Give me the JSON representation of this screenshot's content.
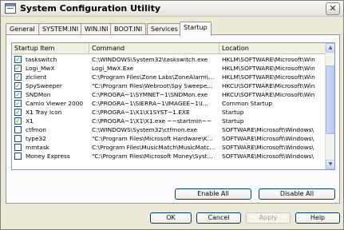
{
  "window": {
    "title": "System Configuration Utility",
    "close_symbol": "✕"
  },
  "tabs": [
    "General",
    "SYSTEM.INI",
    "WIN.INI",
    "BOOT.INI",
    "Services",
    "Startup"
  ],
  "active_tab": "Startup",
  "list": {
    "columns": [
      "Startup Item",
      "Command",
      "Location"
    ],
    "rows": [
      {
        "checked": true,
        "item": "taskswitch",
        "command": "C:\\WINDOWS\\System32\\taskswitch.exe",
        "location": "HKLM\\SOFTWARE\\Microsoft\\Win"
      },
      {
        "checked": true,
        "item": "Logi_MwX",
        "command": "Logi_MwX.Exe",
        "location": "HKLM\\SOFTWARE\\Microsoft\\Win"
      },
      {
        "checked": true,
        "item": "zlclient",
        "command": "C:\\Program Files\\Zone Labs\\ZoneAlarm\\...",
        "location": "HKLM\\SOFTWARE\\Microsoft\\Win"
      },
      {
        "checked": true,
        "item": "SpySweeper",
        "command": "\"C:\\Program Files\\Webroot\\Spy Sweepe...",
        "location": "HKCU\\SOFTWARE\\Microsoft\\Win"
      },
      {
        "checked": true,
        "item": "SNDMon",
        "command": "C:\\PROGRA~1\\SYMNET~1\\SNDMon.exe",
        "location": "HKCU\\SOFTWARE\\Microsoft\\Win"
      },
      {
        "checked": true,
        "item": "Camio Viewer 2000",
        "command": "C:\\PROGRA~1\\SIERRA~1\\IMAGEE~1\\I...",
        "location": "Common Startup"
      },
      {
        "checked": true,
        "item": "X1 Tray Icon",
        "command": "C:\\PROGRA~1\\X1\\X1SYST~1.EXE",
        "location": "Startup"
      },
      {
        "checked": true,
        "item": "X1",
        "command": "C:\\PROGRA~1\\X1\\X1.exe ~~startmin~~",
        "location": "Startup"
      },
      {
        "checked": false,
        "item": "ctfmon",
        "command": "C:\\WINDOWS\\System32\\ctfmon.exe",
        "location": "SOFTWARE\\Microsoft\\Windows\\"
      },
      {
        "checked": false,
        "item": "type32",
        "command": "\"C:\\Program Files\\Microsoft Hardware\\K...",
        "location": "SOFTWARE\\Microsoft\\Windows\\"
      },
      {
        "checked": false,
        "item": "mmtask",
        "command": "C:\\Program Files\\MusicMatch\\MusicMatc...",
        "location": "SOFTWARE\\Microsoft\\Windows\\"
      },
      {
        "checked": false,
        "item": "Money Express",
        "command": "\"C:\\Program Files\\Microsoft Money\\Syst...",
        "location": "SOFTWARE\\Microsoft\\Windows\\"
      }
    ]
  },
  "buttons": {
    "enable_all": "Enable All",
    "disable_all": "Disable All",
    "ok": "OK",
    "cancel": "Cancel",
    "apply": "Apply",
    "help": "Help"
  },
  "icons": {
    "check": "✓",
    "scroll_up": "▲",
    "scroll_down": "▼"
  }
}
